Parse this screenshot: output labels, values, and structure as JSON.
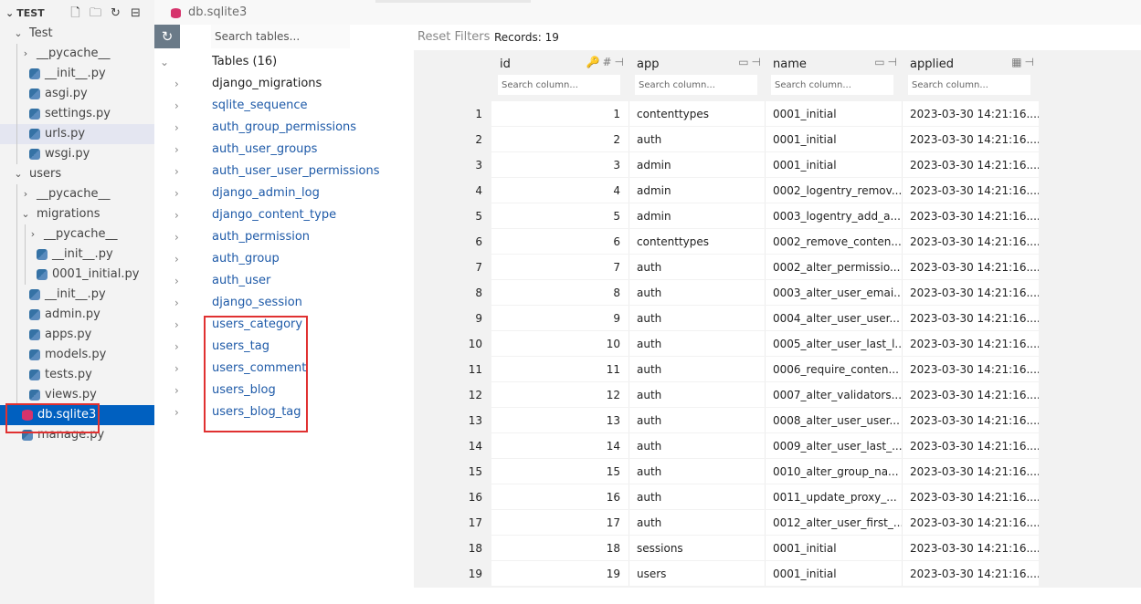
{
  "explorer": {
    "title": "TEST",
    "actions": [
      "new-file-icon",
      "new-folder-icon",
      "refresh-icon",
      "collapse-icon"
    ],
    "items": [
      {
        "label": "Test",
        "type": "folder",
        "expanded": true,
        "depth": 0
      },
      {
        "label": "__pycache__",
        "type": "folder",
        "expanded": false,
        "depth": 1
      },
      {
        "label": "__init__.py",
        "type": "py",
        "depth": 1
      },
      {
        "label": "asgi.py",
        "type": "py",
        "depth": 1
      },
      {
        "label": "settings.py",
        "type": "py",
        "depth": 1
      },
      {
        "label": "urls.py",
        "type": "py",
        "depth": 1
      },
      {
        "label": "wsgi.py",
        "type": "py",
        "depth": 1
      },
      {
        "label": "users",
        "type": "folder",
        "expanded": true,
        "depth": 0
      },
      {
        "label": "__pycache__",
        "type": "folder",
        "expanded": false,
        "depth": 1
      },
      {
        "label": "migrations",
        "type": "folder",
        "expanded": true,
        "depth": 1
      },
      {
        "label": "__pycache__",
        "type": "folder",
        "expanded": false,
        "depth": 2
      },
      {
        "label": "__init__.py",
        "type": "py",
        "depth": 2
      },
      {
        "label": "0001_initial.py",
        "type": "py",
        "depth": 2
      },
      {
        "label": "__init__.py",
        "type": "py",
        "depth": 1
      },
      {
        "label": "admin.py",
        "type": "py",
        "depth": 1
      },
      {
        "label": "apps.py",
        "type": "py",
        "depth": 1
      },
      {
        "label": "models.py",
        "type": "py",
        "depth": 1
      },
      {
        "label": "tests.py",
        "type": "py",
        "depth": 1
      },
      {
        "label": "views.py",
        "type": "py",
        "depth": 1
      },
      {
        "label": "db.sqlite3",
        "type": "db",
        "depth": 0
      },
      {
        "label": "manage.py",
        "type": "py",
        "depth": 0
      }
    ]
  },
  "tab": {
    "label": "db.sqlite3"
  },
  "tables_panel": {
    "search_placeholder": "Search tables...",
    "header": "Tables (16)",
    "tables": [
      "django_migrations",
      "sqlite_sequence",
      "auth_group_permissions",
      "auth_user_groups",
      "auth_user_user_permissions",
      "django_admin_log",
      "django_content_type",
      "auth_permission",
      "auth_group",
      "auth_user",
      "django_session",
      "users_category",
      "users_tag",
      "users_comment",
      "users_blog",
      "users_blog_tag"
    ]
  },
  "grid": {
    "reset_label": "Reset Filters",
    "records_label": "Records: 19",
    "search_placeholder": "Search column...",
    "columns": [
      {
        "name": "id",
        "icons": [
          "key-icon",
          "number-icon",
          "pin-icon"
        ]
      },
      {
        "name": "app",
        "icons": [
          "text-type-icon",
          "pin-icon"
        ]
      },
      {
        "name": "name",
        "icons": [
          "text-type-icon",
          "pin-icon"
        ]
      },
      {
        "name": "applied",
        "icons": [
          "calendar-icon",
          "pin-icon"
        ]
      }
    ],
    "rows": [
      [
        "1",
        "1",
        "contenttypes",
        "0001_initial",
        "2023-03-30 14:21:16...."
      ],
      [
        "2",
        "2",
        "auth",
        "0001_initial",
        "2023-03-30 14:21:16...."
      ],
      [
        "3",
        "3",
        "admin",
        "0001_initial",
        "2023-03-30 14:21:16...."
      ],
      [
        "4",
        "4",
        "admin",
        "0002_logentry_remov...",
        "2023-03-30 14:21:16...."
      ],
      [
        "5",
        "5",
        "admin",
        "0003_logentry_add_a...",
        "2023-03-30 14:21:16...."
      ],
      [
        "6",
        "6",
        "contenttypes",
        "0002_remove_conten...",
        "2023-03-30 14:21:16...."
      ],
      [
        "7",
        "7",
        "auth",
        "0002_alter_permissio...",
        "2023-03-30 14:21:16...."
      ],
      [
        "8",
        "8",
        "auth",
        "0003_alter_user_emai...",
        "2023-03-30 14:21:16...."
      ],
      [
        "9",
        "9",
        "auth",
        "0004_alter_user_user...",
        "2023-03-30 14:21:16...."
      ],
      [
        "10",
        "10",
        "auth",
        "0005_alter_user_last_l...",
        "2023-03-30 14:21:16...."
      ],
      [
        "11",
        "11",
        "auth",
        "0006_require_conten...",
        "2023-03-30 14:21:16...."
      ],
      [
        "12",
        "12",
        "auth",
        "0007_alter_validators...",
        "2023-03-30 14:21:16...."
      ],
      [
        "13",
        "13",
        "auth",
        "0008_alter_user_user...",
        "2023-03-30 14:21:16...."
      ],
      [
        "14",
        "14",
        "auth",
        "0009_alter_user_last_...",
        "2023-03-30 14:21:16...."
      ],
      [
        "15",
        "15",
        "auth",
        "0010_alter_group_na...",
        "2023-03-30 14:21:16...."
      ],
      [
        "16",
        "16",
        "auth",
        "0011_update_proxy_...",
        "2023-03-30 14:21:16...."
      ],
      [
        "17",
        "17",
        "auth",
        "0012_alter_user_first_...",
        "2023-03-30 14:21:16...."
      ],
      [
        "18",
        "18",
        "sessions",
        "0001_initial",
        "2023-03-30 14:21:16...."
      ],
      [
        "19",
        "19",
        "users",
        "0001_initial",
        "2023-03-30 14:21:16...."
      ]
    ]
  },
  "colors": {
    "accent": "#0060c0",
    "link": "#1e5aa8",
    "highlight": "#e03131",
    "db": "#d6336c"
  }
}
